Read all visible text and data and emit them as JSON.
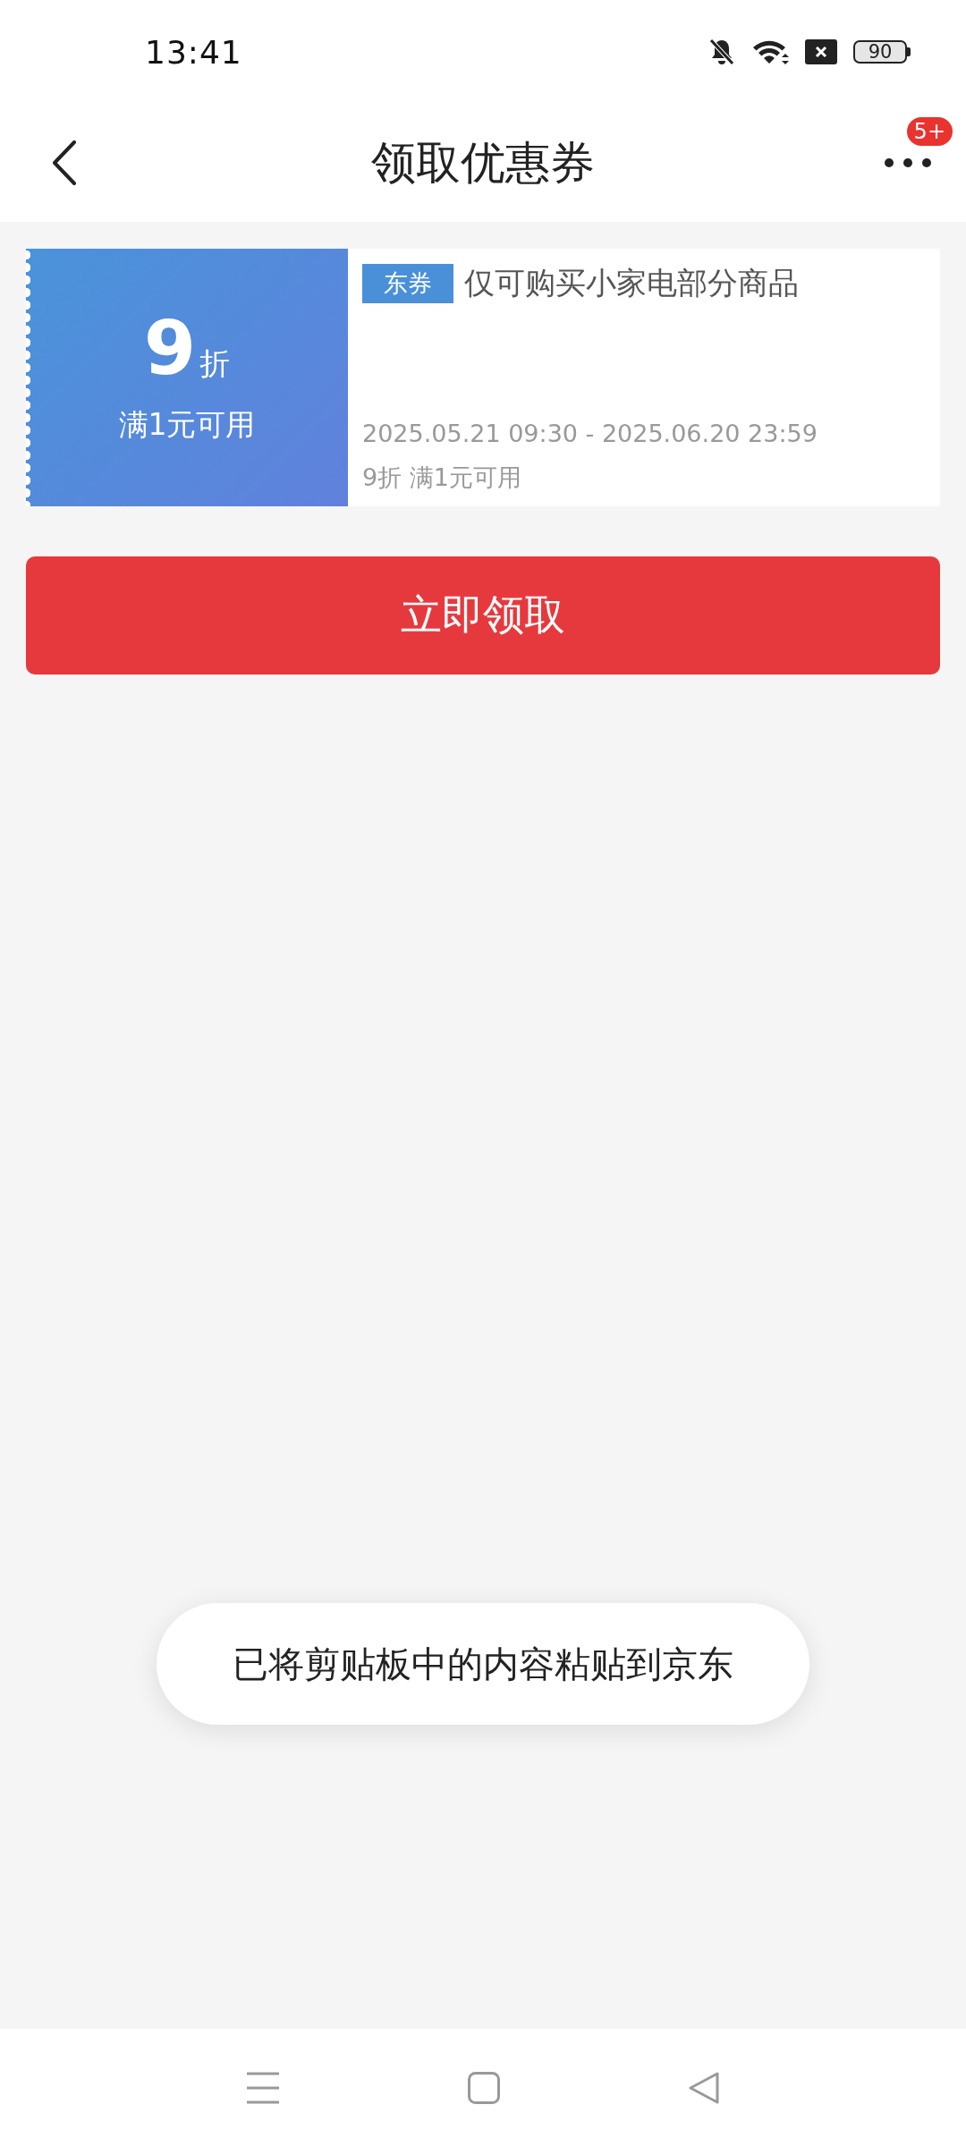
{
  "status_bar": {
    "time": "13:41",
    "battery": "90"
  },
  "header": {
    "title": "领取优惠券",
    "badge": "5+"
  },
  "coupons": [
    {
      "discount": "9",
      "unit": "折",
      "condition": "满1元可用",
      "tag": "东券",
      "description": "仅可购买小家电部分商品",
      "validity": "2025.05.21 09:30 - 2025.06.20 23:59",
      "summary": "9折 满1元可用"
    }
  ],
  "claim_button": {
    "label": "立即领取"
  },
  "toast": {
    "message": "已将剪贴板中的内容粘贴到京东"
  }
}
